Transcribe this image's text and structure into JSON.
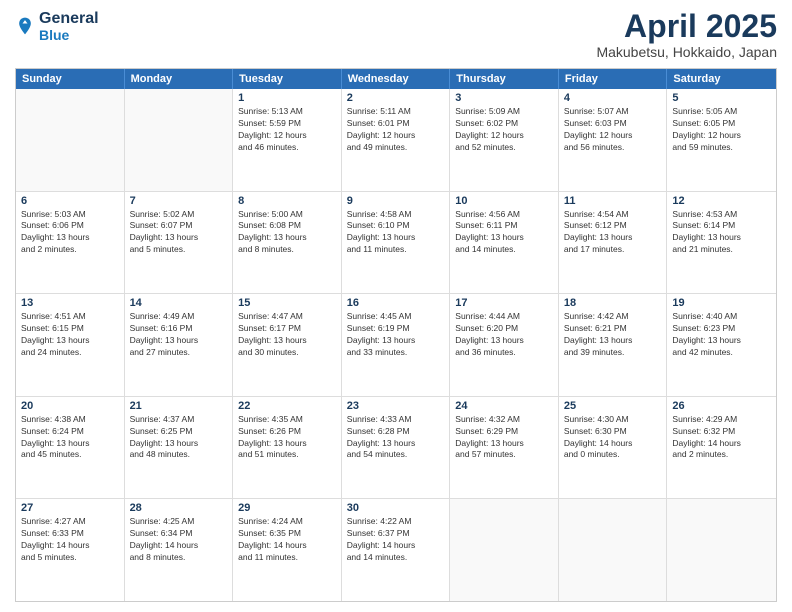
{
  "header": {
    "logo_line1": "General",
    "logo_line2": "Blue",
    "month": "April 2025",
    "location": "Makubetsu, Hokkaido, Japan"
  },
  "day_headers": [
    "Sunday",
    "Monday",
    "Tuesday",
    "Wednesday",
    "Thursday",
    "Friday",
    "Saturday"
  ],
  "weeks": [
    [
      {
        "day": "",
        "info": ""
      },
      {
        "day": "",
        "info": ""
      },
      {
        "day": "1",
        "info": "Sunrise: 5:13 AM\nSunset: 5:59 PM\nDaylight: 12 hours\nand 46 minutes."
      },
      {
        "day": "2",
        "info": "Sunrise: 5:11 AM\nSunset: 6:01 PM\nDaylight: 12 hours\nand 49 minutes."
      },
      {
        "day": "3",
        "info": "Sunrise: 5:09 AM\nSunset: 6:02 PM\nDaylight: 12 hours\nand 52 minutes."
      },
      {
        "day": "4",
        "info": "Sunrise: 5:07 AM\nSunset: 6:03 PM\nDaylight: 12 hours\nand 56 minutes."
      },
      {
        "day": "5",
        "info": "Sunrise: 5:05 AM\nSunset: 6:05 PM\nDaylight: 12 hours\nand 59 minutes."
      }
    ],
    [
      {
        "day": "6",
        "info": "Sunrise: 5:03 AM\nSunset: 6:06 PM\nDaylight: 13 hours\nand 2 minutes."
      },
      {
        "day": "7",
        "info": "Sunrise: 5:02 AM\nSunset: 6:07 PM\nDaylight: 13 hours\nand 5 minutes."
      },
      {
        "day": "8",
        "info": "Sunrise: 5:00 AM\nSunset: 6:08 PM\nDaylight: 13 hours\nand 8 minutes."
      },
      {
        "day": "9",
        "info": "Sunrise: 4:58 AM\nSunset: 6:10 PM\nDaylight: 13 hours\nand 11 minutes."
      },
      {
        "day": "10",
        "info": "Sunrise: 4:56 AM\nSunset: 6:11 PM\nDaylight: 13 hours\nand 14 minutes."
      },
      {
        "day": "11",
        "info": "Sunrise: 4:54 AM\nSunset: 6:12 PM\nDaylight: 13 hours\nand 17 minutes."
      },
      {
        "day": "12",
        "info": "Sunrise: 4:53 AM\nSunset: 6:14 PM\nDaylight: 13 hours\nand 21 minutes."
      }
    ],
    [
      {
        "day": "13",
        "info": "Sunrise: 4:51 AM\nSunset: 6:15 PM\nDaylight: 13 hours\nand 24 minutes."
      },
      {
        "day": "14",
        "info": "Sunrise: 4:49 AM\nSunset: 6:16 PM\nDaylight: 13 hours\nand 27 minutes."
      },
      {
        "day": "15",
        "info": "Sunrise: 4:47 AM\nSunset: 6:17 PM\nDaylight: 13 hours\nand 30 minutes."
      },
      {
        "day": "16",
        "info": "Sunrise: 4:45 AM\nSunset: 6:19 PM\nDaylight: 13 hours\nand 33 minutes."
      },
      {
        "day": "17",
        "info": "Sunrise: 4:44 AM\nSunset: 6:20 PM\nDaylight: 13 hours\nand 36 minutes."
      },
      {
        "day": "18",
        "info": "Sunrise: 4:42 AM\nSunset: 6:21 PM\nDaylight: 13 hours\nand 39 minutes."
      },
      {
        "day": "19",
        "info": "Sunrise: 4:40 AM\nSunset: 6:23 PM\nDaylight: 13 hours\nand 42 minutes."
      }
    ],
    [
      {
        "day": "20",
        "info": "Sunrise: 4:38 AM\nSunset: 6:24 PM\nDaylight: 13 hours\nand 45 minutes."
      },
      {
        "day": "21",
        "info": "Sunrise: 4:37 AM\nSunset: 6:25 PM\nDaylight: 13 hours\nand 48 minutes."
      },
      {
        "day": "22",
        "info": "Sunrise: 4:35 AM\nSunset: 6:26 PM\nDaylight: 13 hours\nand 51 minutes."
      },
      {
        "day": "23",
        "info": "Sunrise: 4:33 AM\nSunset: 6:28 PM\nDaylight: 13 hours\nand 54 minutes."
      },
      {
        "day": "24",
        "info": "Sunrise: 4:32 AM\nSunset: 6:29 PM\nDaylight: 13 hours\nand 57 minutes."
      },
      {
        "day": "25",
        "info": "Sunrise: 4:30 AM\nSunset: 6:30 PM\nDaylight: 14 hours\nand 0 minutes."
      },
      {
        "day": "26",
        "info": "Sunrise: 4:29 AM\nSunset: 6:32 PM\nDaylight: 14 hours\nand 2 minutes."
      }
    ],
    [
      {
        "day": "27",
        "info": "Sunrise: 4:27 AM\nSunset: 6:33 PM\nDaylight: 14 hours\nand 5 minutes."
      },
      {
        "day": "28",
        "info": "Sunrise: 4:25 AM\nSunset: 6:34 PM\nDaylight: 14 hours\nand 8 minutes."
      },
      {
        "day": "29",
        "info": "Sunrise: 4:24 AM\nSunset: 6:35 PM\nDaylight: 14 hours\nand 11 minutes."
      },
      {
        "day": "30",
        "info": "Sunrise: 4:22 AM\nSunset: 6:37 PM\nDaylight: 14 hours\nand 14 minutes."
      },
      {
        "day": "",
        "info": ""
      },
      {
        "day": "",
        "info": ""
      },
      {
        "day": "",
        "info": ""
      }
    ]
  ]
}
